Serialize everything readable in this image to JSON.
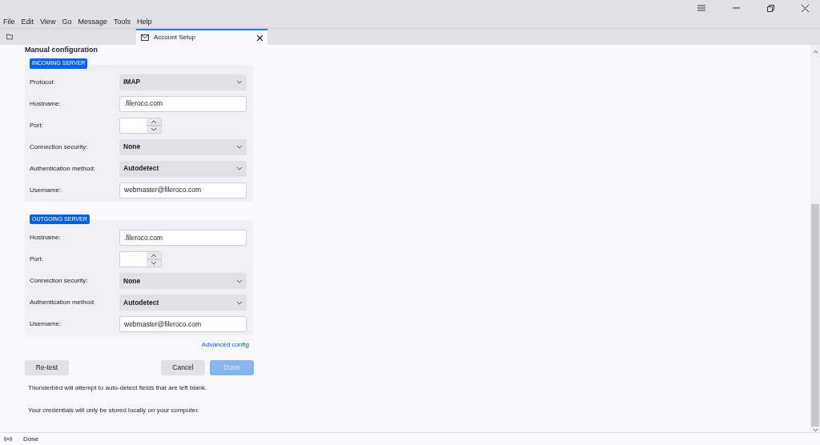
{
  "menu": [
    "File",
    "Edit",
    "View",
    "Go",
    "Message",
    "Tools",
    "Help"
  ],
  "tabs": [
    {
      "kind": "folder",
      "selected": false
    },
    {
      "kind": "account",
      "label": "Account Setup",
      "selected": true
    }
  ],
  "heading": "Manual configuration",
  "sections": [
    {
      "title": "INCOMING SERVER",
      "rows": [
        {
          "kind": "select",
          "label": "Protocol:",
          "value": "IMAP"
        },
        {
          "kind": "text",
          "label": "Hostname:",
          "value": ".fileroco.com"
        },
        {
          "kind": "spinner",
          "label": "Port:"
        },
        {
          "kind": "select",
          "label": "Connection security:",
          "value": "None"
        },
        {
          "kind": "select",
          "label": "Authentication method:",
          "value": "Autodetect"
        },
        {
          "kind": "text",
          "label": "Username:",
          "value": "webmaster@fileroco.com"
        }
      ]
    },
    {
      "title": "OUTGOING SERVER",
      "rows": [
        {
          "kind": "text",
          "label": "Hostname:",
          "value": ".fileroco.com"
        },
        {
          "kind": "spinner",
          "label": "Port:"
        },
        {
          "kind": "select",
          "label": "Connection security:",
          "value": "None"
        },
        {
          "kind": "select",
          "label": "Authentication method:",
          "value": "Autodetect"
        },
        {
          "kind": "text",
          "label": "Username:",
          "value": "webmaster@fileroco.com"
        }
      ]
    }
  ],
  "advanced_link": "Advanced config",
  "buttons": [
    {
      "label": "Re-test",
      "disabled": false
    },
    {
      "label": "Cancel",
      "disabled": false
    },
    {
      "label": "Done",
      "disabled": true
    }
  ],
  "notes": [
    "Thunderbird will attempt to auto-detect fields that are left blank.",
    "Your credentials will only be stored locally on your computer."
  ],
  "status_bar": {
    "text": "Done"
  }
}
